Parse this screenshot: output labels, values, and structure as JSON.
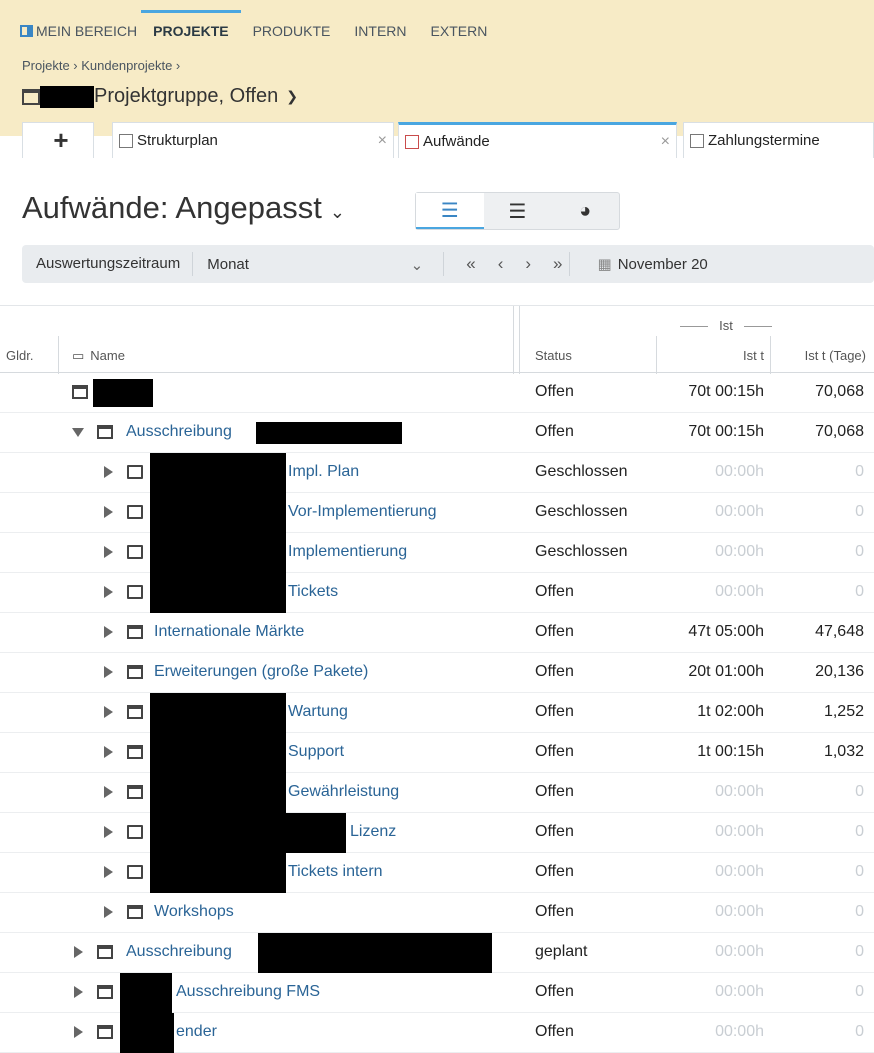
{
  "nav": {
    "items": [
      "MEIN BEREICH",
      "PROJEKTE",
      "PRODUKTE",
      "INTERN",
      "EXTERN"
    ]
  },
  "breadcrumb": "Projekte › Kundenprojekte ›",
  "group_title": "Projektgruppe, Offen",
  "tabs": [
    {
      "label": "+",
      "icon": "plus-icon"
    },
    {
      "label": "Strukturplan",
      "icon": "structure-icon",
      "close": "×"
    },
    {
      "label": "Aufwände",
      "icon": "effort-icon",
      "close": "×"
    },
    {
      "label": "Zahlungstermine",
      "icon": "payment-icon"
    }
  ],
  "page_title": "Aufwände: Angepasst",
  "filter": {
    "label": "Auswertungszeitraum",
    "value": "Monat",
    "month": "November 20"
  },
  "columns": {
    "gldr": "Gldr.",
    "name": "Name",
    "status": "Status",
    "group": "Ist",
    "ist_t": "Ist t",
    "ist_tage": "Ist t (Tage)"
  },
  "rows": [
    {
      "name": "",
      "status": "Offen",
      "ist_t": "70t 00:15h",
      "ist_tage": "70,068"
    },
    {
      "name": "Ausschreibung",
      "status": "Offen",
      "ist_t": "70t 00:15h",
      "ist_tage": "70,068"
    },
    {
      "name": "Impl. Plan",
      "status": "Geschlossen",
      "ist_t": "00:00h",
      "ist_tage": "0"
    },
    {
      "name": "Vor-Implementierung",
      "status": "Geschlossen",
      "ist_t": "00:00h",
      "ist_tage": "0"
    },
    {
      "name": "Implementierung",
      "status": "Geschlossen",
      "ist_t": "00:00h",
      "ist_tage": "0"
    },
    {
      "name": "Tickets",
      "status": "Offen",
      "ist_t": "00:00h",
      "ist_tage": "0"
    },
    {
      "name": "Internationale Märkte",
      "status": "Offen",
      "ist_t": "47t 05:00h",
      "ist_tage": "47,648"
    },
    {
      "name": "Erweiterungen (große Pakete)",
      "status": "Offen",
      "ist_t": "20t 01:00h",
      "ist_tage": "20,136"
    },
    {
      "name": "Wartung",
      "status": "Offen",
      "ist_t": "1t 02:00h",
      "ist_tage": "1,252"
    },
    {
      "name": "Support",
      "status": "Offen",
      "ist_t": "1t 00:15h",
      "ist_tage": "1,032"
    },
    {
      "name": "Gewährleistung",
      "status": "Offen",
      "ist_t": "00:00h",
      "ist_tage": "0"
    },
    {
      "name": "Lizenz",
      "status": "Offen",
      "ist_t": "00:00h",
      "ist_tage": "0"
    },
    {
      "name": "Tickets intern",
      "status": "Offen",
      "ist_t": "00:00h",
      "ist_tage": "0"
    },
    {
      "name": "Workshops",
      "status": "Offen",
      "ist_t": "00:00h",
      "ist_tage": "0"
    },
    {
      "name": "Ausschreibung",
      "status": "geplant",
      "ist_t": "00:00h",
      "ist_tage": "0"
    },
    {
      "name": "Ausschreibung FMS",
      "status": "Offen",
      "ist_t": "00:00h",
      "ist_tage": "0"
    },
    {
      "name": "ender",
      "status": "Offen",
      "ist_t": "00:00h",
      "ist_tage": "0"
    }
  ]
}
